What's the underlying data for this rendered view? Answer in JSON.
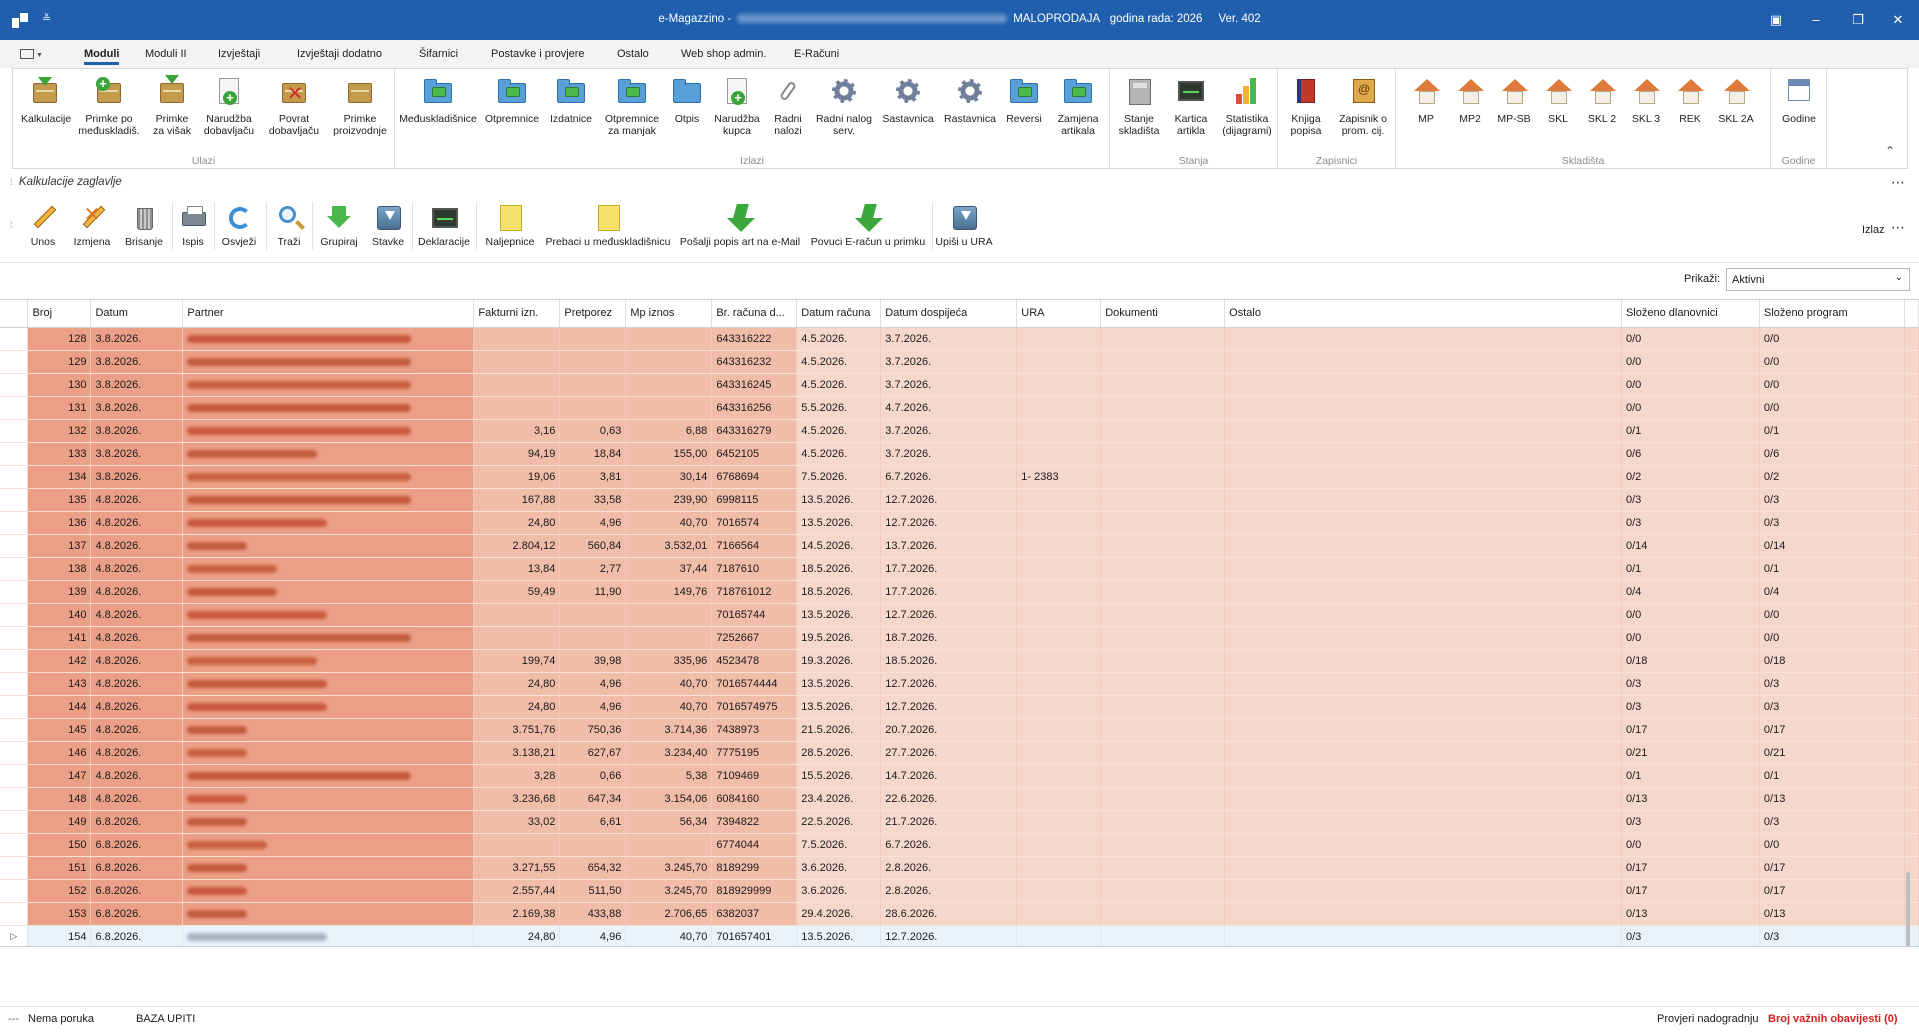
{
  "window": {
    "title_prefix": "e-Magazzino -",
    "title_mode": "MALOPRODAJA",
    "title_year": "godina rada: 2026",
    "title_version": "Ver. 402",
    "ribbon_display_icon": "ribbon-display-icon",
    "minimize": "–",
    "restore": "❐",
    "close": "✕"
  },
  "tabs": [
    "Moduli",
    "Moduli II",
    "Izvještaji",
    "Izvještaji dodatno",
    "Šifarnici",
    "Postavke i provjere",
    "Ostalo",
    "Web shop admin.",
    "E-Računi"
  ],
  "ribbon": {
    "groups": [
      {
        "label": "Ulazi",
        "buttons": [
          {
            "label": "Kalkulacije",
            "icon": "box-arrow-icon"
          },
          {
            "label": "Primke po međuskladiš.",
            "icon": "box-plus-icon"
          },
          {
            "label": "Primke za višak",
            "icon": "box-down-icon"
          },
          {
            "label": "Narudžba dobavljaču",
            "icon": "doc-plus-icon"
          },
          {
            "label": "Povrat dobavljaču",
            "icon": "box-x-icon"
          },
          {
            "label": "Primke proizvodnje",
            "icon": "box-icon"
          }
        ]
      },
      {
        "label": "Izlazi",
        "buttons": [
          {
            "label": "Međuskladišnice",
            "icon": "folder-arrow-icon"
          },
          {
            "label": "Otpremnice",
            "icon": "folder-arrow-icon"
          },
          {
            "label": "Izdatnice",
            "icon": "folder-arrow-icon"
          },
          {
            "label": "Otpremnice za manjak",
            "icon": "folder-arrow-icon"
          },
          {
            "label": "Otpis",
            "icon": "folder-icon"
          },
          {
            "label": "Narudžba kupca",
            "icon": "doc-plus-icon"
          },
          {
            "label": "Radni nalozi",
            "icon": "paperclip-icon"
          },
          {
            "label": "Radni nalog serv.",
            "icon": "gear-icon"
          },
          {
            "label": "Sastavnica",
            "icon": "gear-icon"
          },
          {
            "label": "Rastavnica",
            "icon": "gear-icon"
          },
          {
            "label": "Reversi",
            "icon": "folder-arrow-icon"
          },
          {
            "label": "Zamjena artikala",
            "icon": "folder-arrow-icon"
          }
        ]
      },
      {
        "label": "Stanja",
        "buttons": [
          {
            "label": "Stanje skladišta",
            "icon": "calculator-icon"
          },
          {
            "label": "Kartica artikla",
            "icon": "monitor-icon"
          },
          {
            "label": "Statistika (dijagrami)",
            "icon": "bar-chart-icon"
          }
        ]
      },
      {
        "label": "Zapisnici",
        "buttons": [
          {
            "label": "Knjiga popisa",
            "icon": "book-icon"
          },
          {
            "label": "Zapisnik o prom. cij.",
            "icon": "notebook-icon"
          }
        ]
      },
      {
        "label": "Skladišta",
        "buttons": [
          {
            "label": "MP",
            "icon": "house-icon"
          },
          {
            "label": "MP2",
            "icon": "house-icon"
          },
          {
            "label": "MP-SB",
            "icon": "house-icon"
          },
          {
            "label": "SKL",
            "icon": "house-icon"
          },
          {
            "label": "SKL 2",
            "icon": "house-icon"
          },
          {
            "label": "SKL 3",
            "icon": "house-icon"
          },
          {
            "label": "REK",
            "icon": "house-icon"
          },
          {
            "label": "SKL 2A",
            "icon": "house-icon"
          }
        ]
      },
      {
        "label": "Godine",
        "buttons": [
          {
            "label": "Godine",
            "icon": "calendar-icon"
          }
        ]
      }
    ],
    "collapse_glyph": "⌃"
  },
  "section": {
    "title": "Kalkulacije zaglavlje",
    "menu_glyph": "⋯"
  },
  "toolbar": {
    "buttons": [
      "Unos",
      "Izmjena",
      "Brisanje",
      "Ispis",
      "Osvježi",
      "Traži",
      "Grupiraj",
      "Stavke",
      "Deklaracije",
      "Naljepnice",
      "Prebaci u međuskladišnicu",
      "Pošalji popis art na e-Mail",
      "Povuci E-račun u primku",
      "Upiši u URA"
    ],
    "exit": "Izlaz",
    "menu_glyph": "⋯"
  },
  "filter": {
    "label": "Prikaži:",
    "value": "Aktivni"
  },
  "grid": {
    "columns": [
      "Broj",
      "Datum",
      "Partner",
      "Fakturni izn.",
      "Pretporez",
      "Mp iznos",
      "Br. računa d...",
      "Datum računa",
      "Datum dospijeća",
      "URA",
      "Dokumenti",
      "Ostalo",
      "Složeno dlanovnici",
      "Složeno program"
    ],
    "rows": [
      {
        "broj": "128",
        "datum": "3.8.2026.",
        "fakt": "",
        "pretporez": "",
        "mp": "",
        "racun": "643316222",
        "drac": "4.5.2026.",
        "ddosp": "3.7.2026.",
        "ura": "",
        "sd": "0/0",
        "sp": "0/0"
      },
      {
        "broj": "129",
        "datum": "3.8.2026.",
        "fakt": "",
        "pretporez": "",
        "mp": "",
        "racun": "643316232",
        "drac": "4.5.2026.",
        "ddosp": "3.7.2026.",
        "ura": "",
        "sd": "0/0",
        "sp": "0/0"
      },
      {
        "broj": "130",
        "datum": "3.8.2026.",
        "fakt": "",
        "pretporez": "",
        "mp": "",
        "racun": "643316245",
        "drac": "4.5.2026.",
        "ddosp": "3.7.2026.",
        "ura": "",
        "sd": "0/0",
        "sp": "0/0"
      },
      {
        "broj": "131",
        "datum": "3.8.2026.",
        "fakt": "",
        "pretporez": "",
        "mp": "",
        "racun": "643316256",
        "drac": "5.5.2026.",
        "ddosp": "4.7.2026.",
        "ura": "",
        "sd": "0/0",
        "sp": "0/0"
      },
      {
        "broj": "132",
        "datum": "3.8.2026.",
        "fakt": "3,16",
        "pretporez": "0,63",
        "mp": "6,88",
        "racun": "643316279",
        "drac": "4.5.2026.",
        "ddosp": "3.7.2026.",
        "ura": "",
        "sd": "0/1",
        "sp": "0/1"
      },
      {
        "broj": "133",
        "datum": "3.8.2026.",
        "fakt": "94,19",
        "pretporez": "18,84",
        "mp": "155,00",
        "racun": "6452105",
        "drac": "4.5.2026.",
        "ddosp": "3.7.2026.",
        "ura": "",
        "sd": "0/6",
        "sp": "0/6"
      },
      {
        "broj": "134",
        "datum": "3.8.2026.",
        "fakt": "19,06",
        "pretporez": "3,81",
        "mp": "30,14",
        "racun": "6768694",
        "drac": "7.5.2026.",
        "ddosp": "6.7.2026.",
        "ura": "1- 2383",
        "sd": "0/2",
        "sp": "0/2"
      },
      {
        "broj": "135",
        "datum": "4.8.2026.",
        "fakt": "167,88",
        "pretporez": "33,58",
        "mp": "239,90",
        "racun": "6998115",
        "drac": "13.5.2026.",
        "ddosp": "12.7.2026.",
        "ura": "",
        "sd": "0/3",
        "sp": "0/3"
      },
      {
        "broj": "136",
        "datum": "4.8.2026.",
        "fakt": "24,80",
        "pretporez": "4,96",
        "mp": "40,70",
        "racun": "7016574",
        "drac": "13.5.2026.",
        "ddosp": "12.7.2026.",
        "ura": "",
        "sd": "0/3",
        "sp": "0/3"
      },
      {
        "broj": "137",
        "datum": "4.8.2026.",
        "fakt": "2.804,12",
        "pretporez": "560,84",
        "mp": "3.532,01",
        "racun": "7166564",
        "drac": "14.5.2026.",
        "ddosp": "13.7.2026.",
        "ura": "",
        "sd": "0/14",
        "sp": "0/14"
      },
      {
        "broj": "138",
        "datum": "4.8.2026.",
        "fakt": "13,84",
        "pretporez": "2,77",
        "mp": "37,44",
        "racun": "7187610",
        "drac": "18.5.2026.",
        "ddosp": "17.7.2026.",
        "ura": "",
        "sd": "0/1",
        "sp": "0/1"
      },
      {
        "broj": "139",
        "datum": "4.8.2026.",
        "fakt": "59,49",
        "pretporez": "11,90",
        "mp": "149,76",
        "racun": "718761012",
        "drac": "18.5.2026.",
        "ddosp": "17.7.2026.",
        "ura": "",
        "sd": "0/4",
        "sp": "0/4"
      },
      {
        "broj": "140",
        "datum": "4.8.2026.",
        "fakt": "",
        "pretporez": "",
        "mp": "",
        "racun": "70165744",
        "drac": "13.5.2026.",
        "ddosp": "12.7.2026.",
        "ura": "",
        "sd": "0/0",
        "sp": "0/0"
      },
      {
        "broj": "141",
        "datum": "4.8.2026.",
        "fakt": "",
        "pretporez": "",
        "mp": "",
        "racun": "7252667",
        "drac": "19.5.2026.",
        "ddosp": "18.7.2026.",
        "ura": "",
        "sd": "0/0",
        "sp": "0/0"
      },
      {
        "broj": "142",
        "datum": "4.8.2026.",
        "fakt": "199,74",
        "pretporez": "39,98",
        "mp": "335,96",
        "racun": "4523478",
        "drac": "19.3.2026.",
        "ddosp": "18.5.2026.",
        "ura": "",
        "sd": "0/18",
        "sp": "0/18"
      },
      {
        "broj": "143",
        "datum": "4.8.2026.",
        "fakt": "24,80",
        "pretporez": "4,96",
        "mp": "40,70",
        "racun": "7016574444",
        "drac": "13.5.2026.",
        "ddosp": "12.7.2026.",
        "ura": "",
        "sd": "0/3",
        "sp": "0/3"
      },
      {
        "broj": "144",
        "datum": "4.8.2026.",
        "fakt": "24,80",
        "pretporez": "4,96",
        "mp": "40,70",
        "racun": "7016574975",
        "drac": "13.5.2026.",
        "ddosp": "12.7.2026.",
        "ura": "",
        "sd": "0/3",
        "sp": "0/3"
      },
      {
        "broj": "145",
        "datum": "4.8.2026.",
        "fakt": "3.751,76",
        "pretporez": "750,36",
        "mp": "3.714,36",
        "racun": "7438973",
        "drac": "21.5.2026.",
        "ddosp": "20.7.2026.",
        "ura": "",
        "sd": "0/17",
        "sp": "0/17"
      },
      {
        "broj": "146",
        "datum": "4.8.2026.",
        "fakt": "3.138,21",
        "pretporez": "627,67",
        "mp": "3.234,40",
        "racun": "7775195",
        "drac": "28.5.2026.",
        "ddosp": "27.7.2026.",
        "ura": "",
        "sd": "0/21",
        "sp": "0/21"
      },
      {
        "broj": "147",
        "datum": "4.8.2026.",
        "fakt": "3,28",
        "pretporez": "0,66",
        "mp": "5,38",
        "racun": "7109469",
        "drac": "15.5.2026.",
        "ddosp": "14.7.2026.",
        "ura": "",
        "sd": "0/1",
        "sp": "0/1"
      },
      {
        "broj": "148",
        "datum": "4.8.2026.",
        "fakt": "3.236,68",
        "pretporez": "647,34",
        "mp": "3.154,06",
        "racun": "6084160",
        "drac": "23.4.2026.",
        "ddosp": "22.6.2026.",
        "ura": "",
        "sd": "0/13",
        "sp": "0/13"
      },
      {
        "broj": "149",
        "datum": "6.8.2026.",
        "fakt": "33,02",
        "pretporez": "6,61",
        "mp": "56,34",
        "racun": "7394822",
        "drac": "22.5.2026.",
        "ddosp": "21.7.2026.",
        "ura": "",
        "sd": "0/3",
        "sp": "0/3"
      },
      {
        "broj": "150",
        "datum": "6.8.2026.",
        "fakt": "",
        "pretporez": "",
        "mp": "",
        "racun": "6774044",
        "drac": "7.5.2026.",
        "ddosp": "6.7.2026.",
        "ura": "",
        "sd": "0/0",
        "sp": "0/0"
      },
      {
        "broj": "151",
        "datum": "6.8.2026.",
        "fakt": "3.271,55",
        "pretporez": "654,32",
        "mp": "3.245,70",
        "racun": "8189299",
        "drac": "3.6.2026.",
        "ddosp": "2.8.2026.",
        "ura": "",
        "sd": "0/17",
        "sp": "0/17"
      },
      {
        "broj": "152",
        "datum": "6.8.2026.",
        "fakt": "2.557,44",
        "pretporez": "511,50",
        "mp": "3.245,70",
        "racun": "818929999",
        "drac": "3.6.2026.",
        "ddosp": "2.8.2026.",
        "ura": "",
        "sd": "0/17",
        "sp": "0/17"
      },
      {
        "broj": "153",
        "datum": "6.8.2026.",
        "fakt": "2.169,38",
        "pretporez": "433,88",
        "mp": "2.706,65",
        "racun": "6382037",
        "drac": "29.4.2026.",
        "ddosp": "28.6.2026.",
        "ura": "",
        "sd": "0/13",
        "sp": "0/13"
      },
      {
        "broj": "154",
        "datum": "6.8.2026.",
        "fakt": "24,80",
        "pretporez": "4,96",
        "mp": "40,70",
        "racun": "701657401",
        "drac": "13.5.2026.",
        "ddosp": "12.7.2026.",
        "ura": "",
        "sd": "0/3",
        "sp": "0/3"
      }
    ],
    "selected_row_index": 26,
    "row_pointer_glyph": "▷"
  },
  "status": {
    "left_glyph": "---",
    "message": "Nema poruka",
    "db": "BAZA UPITI",
    "check_updates": "Provjeri nadogradnju",
    "notices": "Broj važnih obavijesti (0)"
  },
  "colors": {
    "titlebar": "#1f5fad",
    "highlight_row_left": "#eb9f86",
    "highlight_row_right": "#f6d7cb",
    "notices_text": "#d41f1f"
  }
}
